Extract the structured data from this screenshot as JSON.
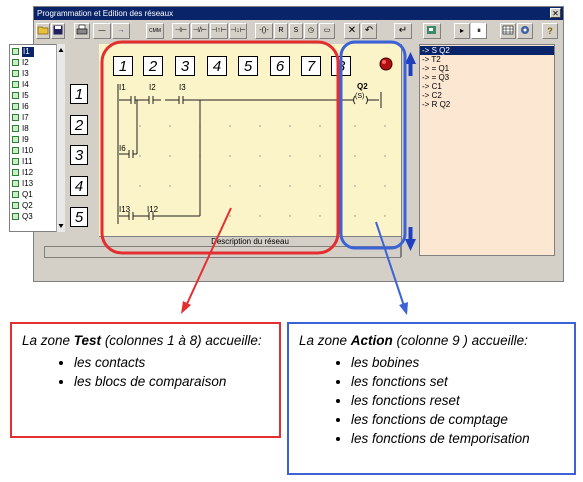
{
  "window": {
    "title": "Programmation et Edition des réseaux",
    "close_glyph": "✕"
  },
  "toolbar": {
    "buttons": [
      {
        "name": "open-folder",
        "text": ""
      },
      {
        "name": "save",
        "text": ""
      },
      {
        "name": "print",
        "text": ""
      },
      {
        "name": "horizontal-line",
        "text": "—"
      },
      {
        "name": "arrow-right",
        "text": "→"
      },
      {
        "name": "comment",
        "text": "CMM"
      },
      {
        "name": "contact-no",
        "text": "⊣⊢"
      },
      {
        "name": "contact-nc",
        "text": "⊣/⊢"
      },
      {
        "name": "rising-edge",
        "text": "⊣↑⊢"
      },
      {
        "name": "falling-edge",
        "text": "⊣↓⊢"
      },
      {
        "name": "coil",
        "text": "-()-"
      },
      {
        "name": "reset",
        "text": "R"
      },
      {
        "name": "set",
        "text": "S"
      },
      {
        "name": "timer",
        "text": "◷"
      },
      {
        "name": "counter",
        "text": "▭"
      },
      {
        "name": "delete",
        "text": "✕"
      },
      {
        "name": "undo",
        "text": "↶"
      },
      {
        "name": "return",
        "text": "↵"
      },
      {
        "name": "transfer",
        "text": ""
      },
      {
        "name": "mode-run",
        "text": "▸"
      },
      {
        "name": "mode-pause",
        "text": "⏸"
      },
      {
        "name": "grid",
        "text": ""
      },
      {
        "name": "view",
        "text": ""
      },
      {
        "name": "help",
        "text": "?"
      }
    ]
  },
  "inputs_list": {
    "items": [
      "I1",
      "I2",
      "I3",
      "I4",
      "I5",
      "I6",
      "I7",
      "I8",
      "I9",
      "I10",
      "I11",
      "I12",
      "I13",
      "Q1",
      "Q2",
      "Q3"
    ],
    "selected_index": 0
  },
  "row_numbers": [
    "1",
    "2",
    "3",
    "4",
    "5"
  ],
  "column_numbers": [
    "1",
    "2",
    "3",
    "4",
    "5",
    "6",
    "7",
    "8"
  ],
  "ladder": {
    "contacts": [
      {
        "label": "I1"
      },
      {
        "label": "I2"
      },
      {
        "label": "I3"
      },
      {
        "label": "I6"
      },
      {
        "label": "I13"
      },
      {
        "label": "I12"
      }
    ],
    "coil": {
      "label": "Q2",
      "symbol": "(S)"
    },
    "description_label": "Description du réseau"
  },
  "right_list": {
    "items": [
      "S Q2",
      "T2",
      "= Q1",
      "= Q3",
      "C1",
      "C2",
      "R Q2"
    ],
    "selected_index": 0
  },
  "info_test": {
    "prefix": "La zone ",
    "zone": "Test",
    "suffix": " (colonnes 1 à 8) accueille:",
    "items": [
      "les contacts",
      "les blocs de comparaison"
    ]
  },
  "info_action": {
    "prefix": "La zone ",
    "zone": "Action",
    "suffix": " (colonne 9 ) accueille:",
    "items": [
      "les bobines",
      "les fonctions set",
      "les fonctions reset",
      "les fonctions de comptage",
      "les fonctions de temporisation"
    ]
  },
  "colors": {
    "test_zone": "#e32f2f",
    "action_zone": "#3c63d6",
    "ladder_bg": "#fbf4c8",
    "list_bg": "#fbe7d2",
    "titlebar": "#0a246a"
  }
}
